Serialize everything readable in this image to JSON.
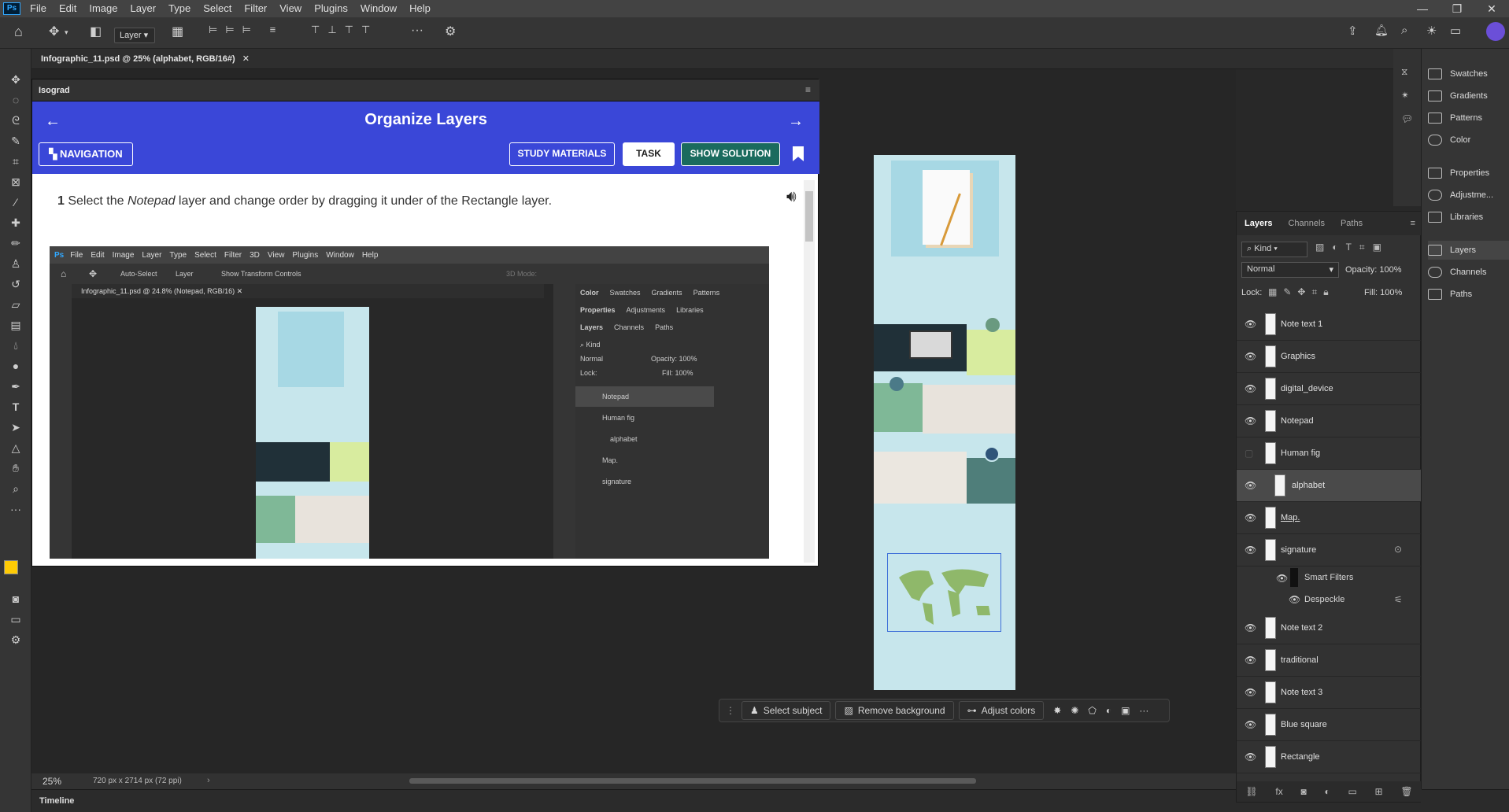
{
  "app": {
    "logo": "Ps",
    "menu": [
      "File",
      "Edit",
      "Image",
      "Layer",
      "Type",
      "Select",
      "Filter",
      "View",
      "Plugins",
      "Window",
      "Help"
    ]
  },
  "options": {
    "layer_select": "Layer"
  },
  "document": {
    "tab_title": "Infographic_11.psd @ 25% (alphabet, RGB/16#)",
    "zoom": "25%",
    "dimensions": "720 px x 2714 px (72 ppi)"
  },
  "isograd": {
    "panel_title": "Isograd",
    "title": "Organize Layers",
    "nav_button": "NAVIGATION",
    "study_button": "STUDY MATERIALS",
    "task_button": "TASK",
    "solution_button": "SHOW SOLUTION",
    "instruction_num": "1",
    "instruction_pre": "Select the",
    "instruction_em": "Notepad",
    "instruction_post": "layer and change order by dragging it under of the Rectangle layer.",
    "inner": {
      "menu": [
        "File",
        "Edit",
        "Image",
        "Layer",
        "Type",
        "Select",
        "Filter",
        "3D",
        "View",
        "Plugins",
        "Window",
        "Help"
      ],
      "auto_select": "Auto-Select",
      "layer_select": "Layer",
      "transform": "Show Transform Controls",
      "mode_3d": "3D Mode:",
      "tab": "Infographic_11.psd @ 24.8% (Notepad, RGB/16)",
      "panel_tabs1": [
        "Color",
        "Swatches",
        "Gradients",
        "Patterns"
      ],
      "panel_tabs2": [
        "Properties",
        "Adjustments",
        "Libraries"
      ],
      "panel_tabs3": [
        "Layers",
        "Channels",
        "Paths"
      ],
      "kind": "Kind",
      "blend": "Normal",
      "opacity_label": "Opacity:",
      "opacity": "100%",
      "lock_label": "Lock:",
      "fill_label": "Fill:",
      "fill": "100%",
      "layers": [
        "Notepad",
        "Human fig",
        "alphabet",
        "Map.",
        "signature"
      ]
    }
  },
  "ctxbar": {
    "select_subject": "Select subject",
    "remove_background": "Remove background",
    "adjust_colors": "Adjust colors"
  },
  "timeline": "Timeline",
  "layers_panel": {
    "tabs": [
      "Layers",
      "Channels",
      "Paths"
    ],
    "kind": "Kind",
    "blend": "Normal",
    "opacity_label": "Opacity:",
    "opacity": "100%",
    "lock_label": "Lock:",
    "fill_label": "Fill:",
    "fill": "100%",
    "layers": [
      "Note text 1",
      "Graphics",
      "digital_device",
      "Notepad",
      "Human fig",
      "alphabet",
      "Map.",
      "signature"
    ],
    "smart_filters": "Smart Filters",
    "despeckle": "Despeckle",
    "layers2": [
      "Note text 2",
      "traditional",
      "Note text 3",
      "Blue square",
      "Rectangle"
    ]
  },
  "right_panels": [
    "Swatches",
    "Gradients",
    "Patterns",
    "Color",
    "Properties",
    "Adjustme...",
    "Libraries",
    "Layers",
    "Channels",
    "Paths"
  ],
  "colors": {
    "accent": "#3a47d8",
    "ui_dark": "#323232",
    "canvas_bg": "#c7e6ec",
    "solution_btn": "#1a6b5e",
    "fg_swatch": "#ffcb05"
  }
}
